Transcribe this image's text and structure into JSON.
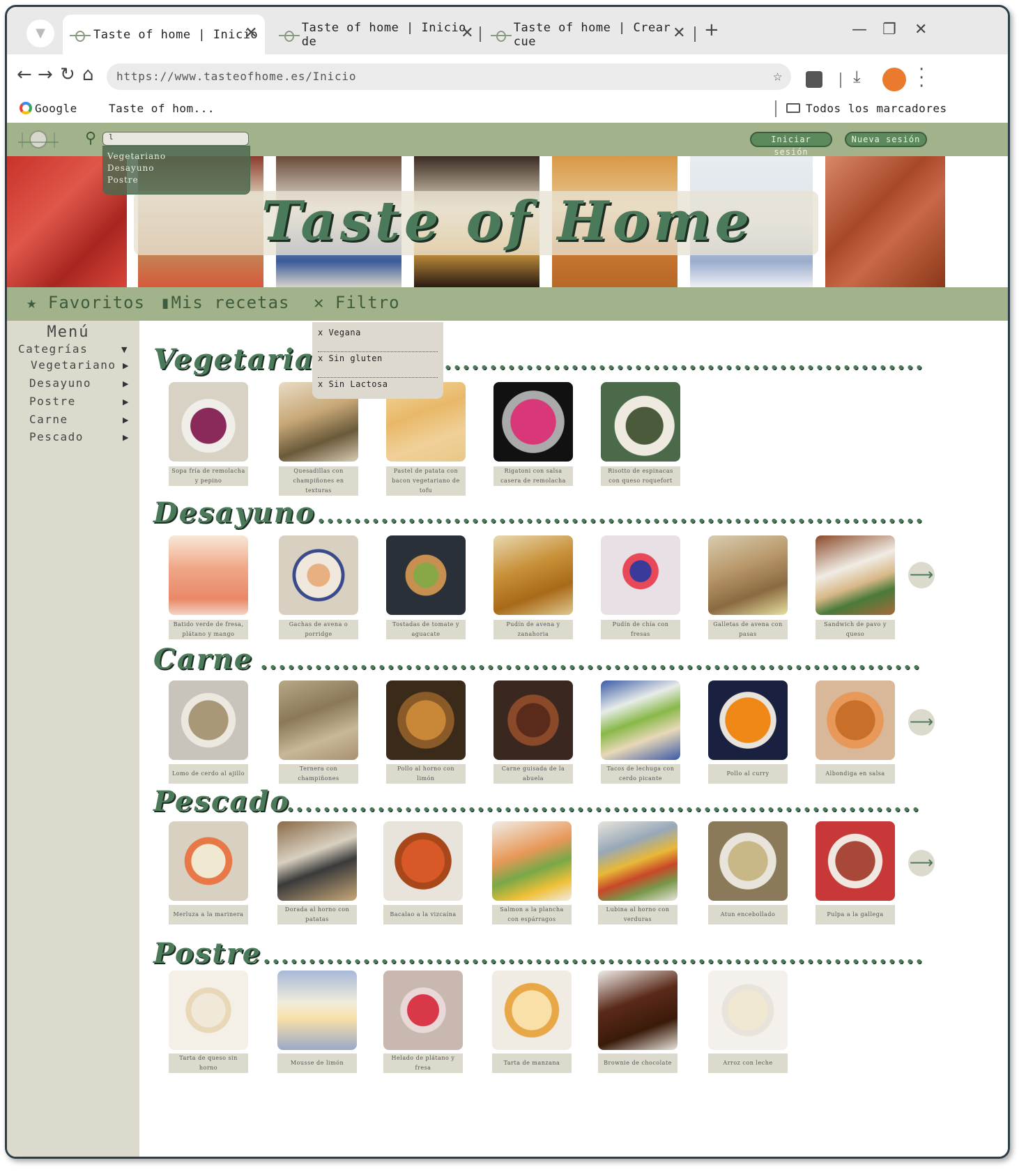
{
  "browser": {
    "tabs": [
      {
        "title": "Taste of home | Inicio"
      },
      {
        "title": "Taste of home | Inicio de"
      },
      {
        "title": "Taste of home | Crear cue"
      }
    ],
    "url": "https://www.tasteofhome.es/Inicio",
    "bookmarks": [
      "Google",
      "Taste of hom..."
    ],
    "all_bookmarks": "Todos los marcadores",
    "profile_color": "#ea7a2e"
  },
  "site": {
    "title": "Taste of Home",
    "search": {
      "value": "l",
      "suggestions": [
        "Vegetariano",
        "Desayuno",
        "Postre"
      ]
    },
    "login_button": "Iniciar sesión",
    "new_session_button": "Nueva sesión",
    "subnav": [
      "Favoritos",
      "Mis recetas",
      "Filtro"
    ],
    "filter_options": [
      "x Vegana",
      "x Sin gluten",
      "x Sin Lactosa"
    ],
    "accent": "#a2b38b",
    "title_green": "#4b7a5a"
  },
  "sidebar": {
    "title": "Menú",
    "categories_label": "Categrías",
    "items": [
      "Vegetariano",
      "Desayuno",
      "Postre",
      "Carne",
      "Pescado"
    ]
  },
  "sections": [
    {
      "title": "Vegetariano",
      "items": [
        "Sopa fría de remolacha y pepino",
        "Quesadillas con champiñones en texturas",
        "Pastel de patata con bacon vegetariano de tofu",
        "Rigatoni con salsa casera de remolacha",
        "Risotto de espinacas con queso roquefort"
      ]
    },
    {
      "title": "Desayuno",
      "items": [
        "Batido verde de fresa, plátano y mango",
        "Gachas de avena o porridge",
        "Tostadas de tomate y aguacate",
        "Pudín de avena y zanahoria",
        "Pudín de chía con fresas",
        "Galletas de avena con pasas",
        "Sandwich de pavo y queso"
      ]
    },
    {
      "title": "Carne",
      "items": [
        "Lomo de cerdo al ajillo",
        "Ternera con champiñones",
        "Pollo al horno con limón",
        "Carne guisada de la abuela",
        "Tacos de lechuga con cerdo picante",
        "Pollo al curry",
        "Albondiga en salsa"
      ]
    },
    {
      "title": "Pescado",
      "items": [
        "Merluza a la marinera",
        "Dorada al horno con patatas",
        "Bacalao a la vizcaína",
        "Salmon a la plancha con espárragos",
        "Lubina al horno con verduras",
        "Atun encebollado",
        "Pulpa a la gallega"
      ]
    },
    {
      "title": "Postre",
      "items": [
        "Tarta de queso sin horno",
        "Mousse de limón",
        "Helado de plátano y fresa",
        "Tarta de manzana",
        "Brownie de chocolate",
        "Arroz con leche"
      ]
    }
  ]
}
